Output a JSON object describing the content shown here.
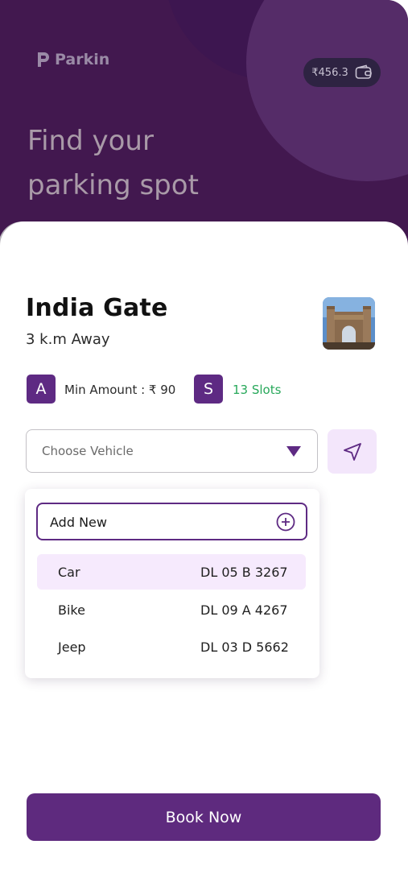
{
  "app": {
    "name": "Parkin"
  },
  "wallet": {
    "balance": "₹456.3",
    "icon": "wallet-icon"
  },
  "header": {
    "line1": "Find your",
    "line2": "parking spot"
  },
  "location": {
    "name": "India Gate",
    "distance": "3 k.m Away",
    "image": "monument-thumbnail"
  },
  "info": {
    "badge_a": "A",
    "min_amount": "Min Amount : ₹ 90",
    "badge_s": "S",
    "slots": "13 Slots"
  },
  "vehicle_select": {
    "placeholder": "Choose Vehicle",
    "icon": "caret-down-icon"
  },
  "locate_button": {
    "icon": "navigation-arrow-icon"
  },
  "dropdown": {
    "add_new_label": "Add New",
    "add_icon": "plus-circle-icon",
    "vehicles": [
      {
        "name": "Car",
        "plate": "DL 05 B 3267",
        "selected": true
      },
      {
        "name": "Bike",
        "plate": "DL 09 A 4267",
        "selected": false
      },
      {
        "name": "Jeep",
        "plate": "DL 03 D 5662",
        "selected": false
      }
    ]
  },
  "book_button": {
    "label": "Book Now"
  },
  "colors": {
    "header_bg": "#42184f",
    "accent": "#5e2a83",
    "slots_green": "#27a85a",
    "selected_row": "#f6eafd"
  }
}
